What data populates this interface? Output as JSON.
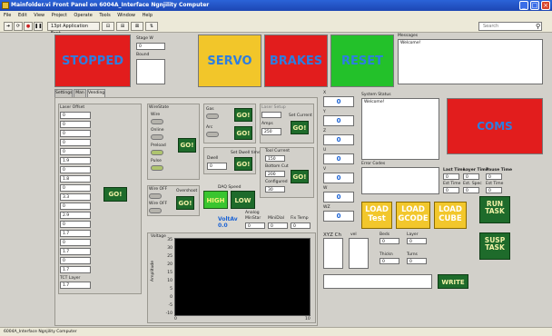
{
  "window": {
    "title": "Mainfolder.vi Front Panel on 6004A_Interface Ngnjility Computer",
    "minimize": "_",
    "maximize": "□",
    "close": "×"
  },
  "menu": [
    "File",
    "Edit",
    "View",
    "Project",
    "Operate",
    "Tools",
    "Window",
    "Help"
  ],
  "toolbar": {
    "font_select": "13pt Application Font",
    "search_placeholder": "Search"
  },
  "top": {
    "stage_label": "Stage W",
    "stage_value": "0",
    "second_label": "Bound",
    "stopped": "STOPPED",
    "servo": "SERVO",
    "brakes": "BRAKES",
    "reset": "RESET",
    "messages_label": "Messages",
    "messages_value": "Welcome!",
    "colors": {
      "stopped": "#e21d1d",
      "servo": "#f2c62a",
      "brakes": "#e21d1d",
      "reset": "#23c12a",
      "text": "#2d7ee0"
    }
  },
  "tabs": [
    "Settings",
    "Man",
    "Vending"
  ],
  "laser_offset": {
    "label": "Laser Offset",
    "rows": [
      "0",
      "0",
      "0",
      "0",
      "0",
      "1.9",
      "0",
      "1.8",
      "0",
      "3.3",
      "0",
      "2.9",
      "0",
      "1.7",
      "0",
      "1.7",
      "0",
      "1.7"
    ],
    "last_label": "TCT Layer",
    "last_value": "1.7",
    "go": "GO!"
  },
  "wire_state": {
    "label": "WireState",
    "items": [
      "Wire",
      "Online",
      "Preload",
      "Pulse"
    ],
    "go": "GO!"
  },
  "gas": {
    "label": "Gas",
    "go": "GO!"
  },
  "arc": {
    "label": "Arc",
    "go": "GO!"
  },
  "laser_panel": {
    "label": "Laser Setup",
    "set_current_label": "Set Current",
    "amps_label": "Amps",
    "amps_value": "250",
    "go": "GO!"
  },
  "duration": {
    "label": "Dwell",
    "value": "0",
    "set_label": "Set Dwell time",
    "go": "GO!"
  },
  "currents": {
    "label1": "Tool Current",
    "value1": "150",
    "label2": "Bottom Cut",
    "value2": "200",
    "label3": "Configured",
    "value3": "30",
    "go": "GO!"
  },
  "wire_off": {
    "label1": "Wire OFF",
    "label2": "Wire OFF",
    "side_label": "Overshoot",
    "go": "GO!"
  },
  "daq_speed": {
    "label": "DAQ Speed",
    "high": "HIGH",
    "low": "LOW"
  },
  "readings": {
    "title": "Analog",
    "voltage_label": "VoltAv",
    "voltage_value": "0.0",
    "col1": "MinStar",
    "col2": "MiniDial",
    "col3": "Fix Temp",
    "v1": "0",
    "v2": "0",
    "v3": "0"
  },
  "plot": {
    "title": "Voltage",
    "ylabel": "Amplitude",
    "y_ticks": [
      "35",
      "30",
      "25",
      "20",
      "15",
      "10",
      "5",
      "0",
      "-5",
      "-10"
    ],
    "x_start": "0",
    "x_end": "10"
  },
  "axes": {
    "labels": [
      "X",
      "Y",
      "Z",
      "U",
      "V",
      "W",
      "WZ"
    ],
    "values": [
      "0",
      "0",
      "0",
      "0",
      "0",
      "0",
      "0"
    ]
  },
  "system_status": {
    "label": "System Status",
    "value": "Welcome!"
  },
  "coms": "COMS",
  "error_codes_label": "Error Codes",
  "timing": {
    "headers": [
      "Last Time",
      "Layer Time",
      "Pause Time"
    ],
    "values": [
      "0",
      "0",
      "0"
    ],
    "sub_labels": [
      "Est Time",
      "Est. Spec",
      "Est Time"
    ],
    "sub_values": [
      "0",
      "0",
      "0"
    ]
  },
  "loads": {
    "test": [
      "LOAD",
      "Test"
    ],
    "gcode": [
      "LOAD",
      "GCODE"
    ],
    "cube": [
      "LOAD",
      "CUBE"
    ]
  },
  "run_task": [
    "RUN",
    "TASK"
  ],
  "susp_task": [
    "SUSP",
    "TASK"
  ],
  "xyz": {
    "label": "XYZ Ch",
    "vel_label": "vel",
    "bed_label": "Beds",
    "layer_label": "Layer",
    "thickn_label": "Thickn",
    "turns_label": "Turns",
    "bed_value": "0",
    "layer_value": "0",
    "thickn_value": "0",
    "turns_value": "0"
  },
  "write": "WRITE",
  "status_bar": "6004A_Interface Ngnjility Computer"
}
